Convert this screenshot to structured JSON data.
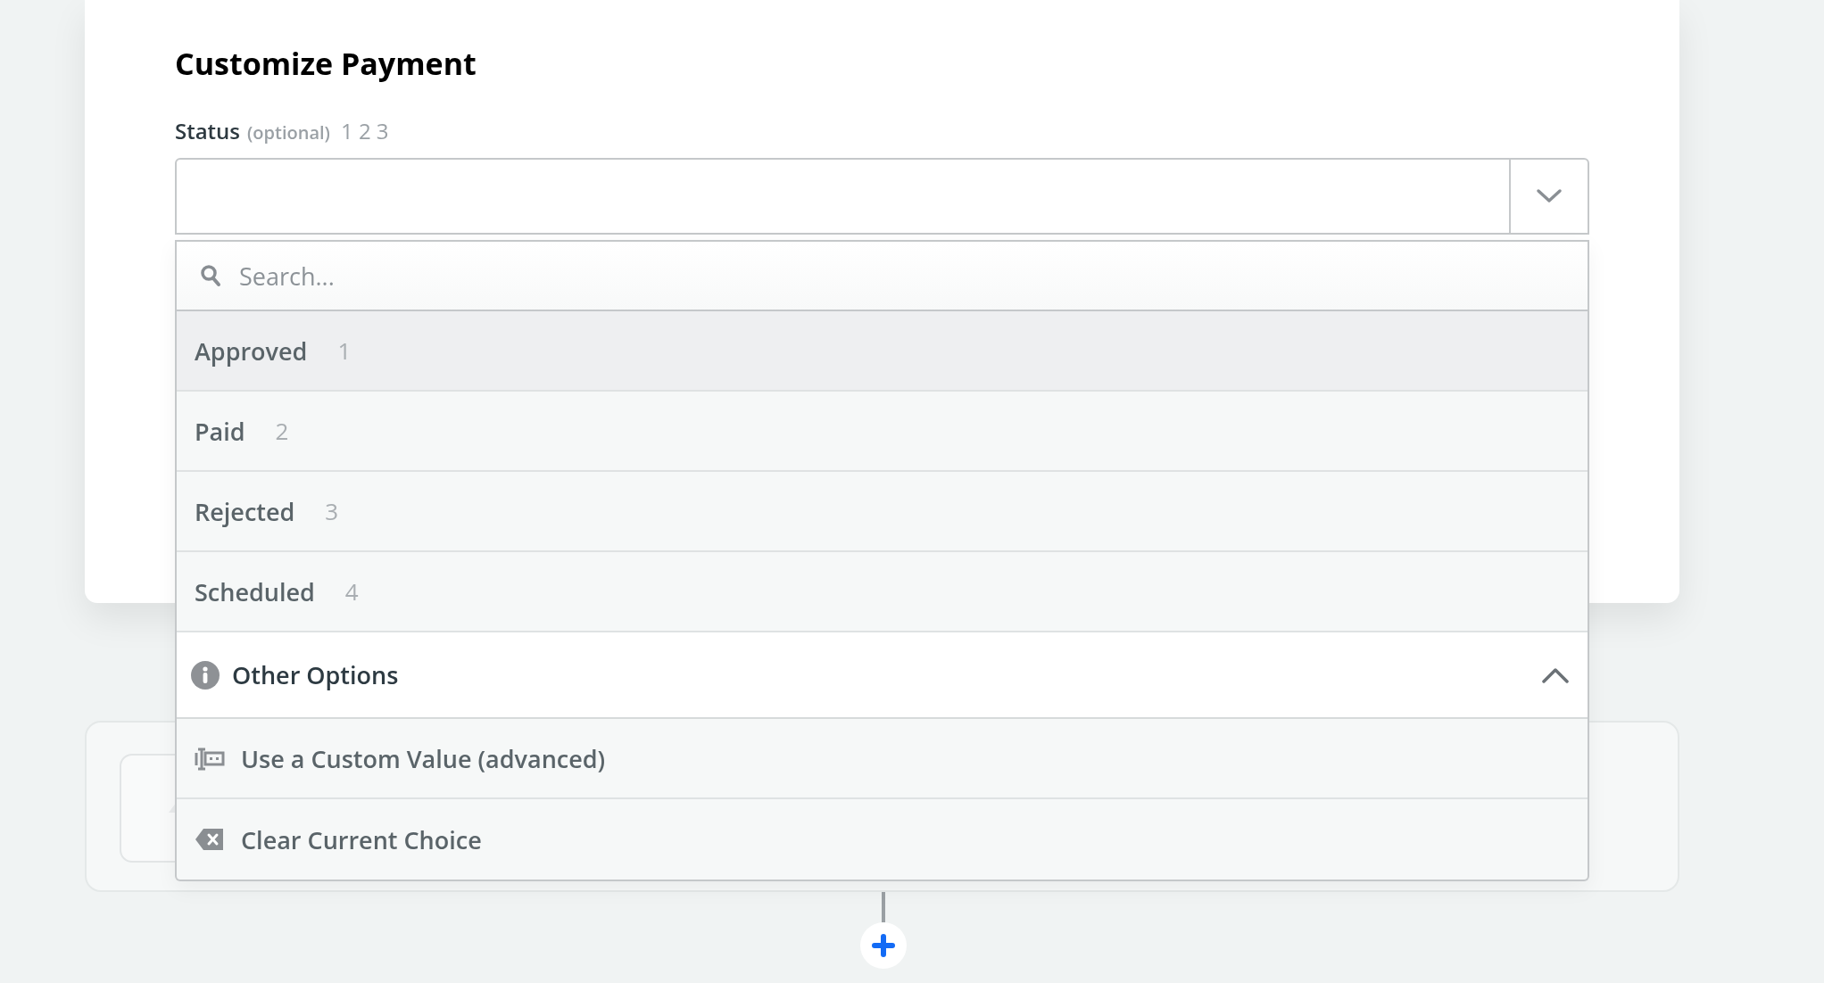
{
  "form": {
    "title": "Customize Payment",
    "field": {
      "label": "Status",
      "optional": "(optional)",
      "hint": "1 2 3",
      "expanded": true
    }
  },
  "dropdown": {
    "search": {
      "placeholder": "Search..."
    },
    "options": [
      {
        "label": "Approved",
        "value": "1",
        "selected": true
      },
      {
        "label": "Paid",
        "value": "2",
        "selected": false
      },
      {
        "label": "Rejected",
        "value": "3",
        "selected": false
      },
      {
        "label": "Scheduled",
        "value": "4",
        "selected": false
      }
    ],
    "other_options": {
      "label": "Other Options",
      "expanded": true,
      "items": [
        {
          "kind": "custom",
          "label": "Use a Custom Value (advanced)"
        },
        {
          "kind": "clear",
          "label": "Clear Current Choice"
        }
      ]
    }
  }
}
